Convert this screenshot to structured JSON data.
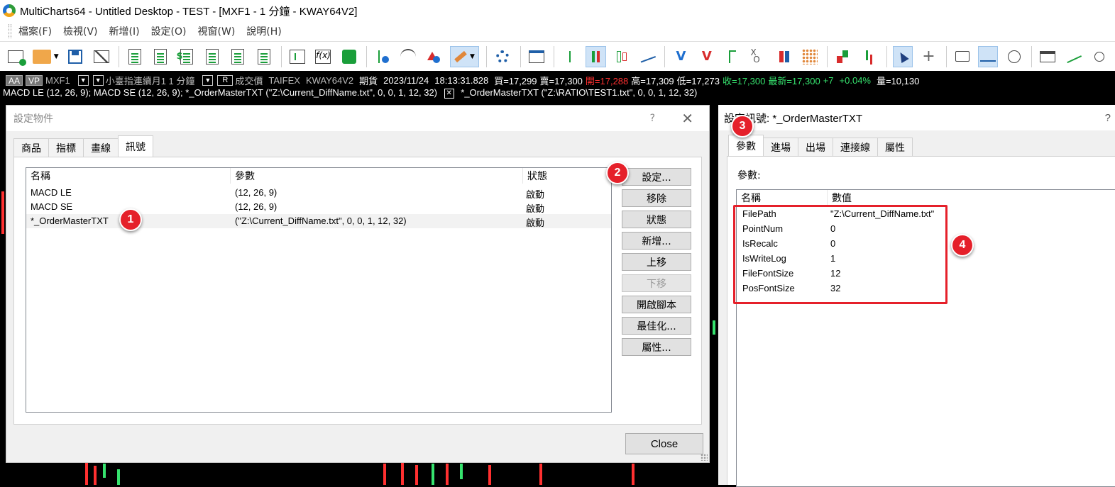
{
  "window": {
    "title": "MultiCharts64 - Untitled Desktop - TEST - [MXF1 - 1 分鐘 - KWAY64V2]"
  },
  "menu": [
    "檔案(F)",
    "檢視(V)",
    "新增(I)",
    "設定(O)",
    "視窗(W)",
    "說明(H)"
  ],
  "infobar": {
    "aa": "AA",
    "vp": "VP",
    "symbol": "MXF1",
    "desc": "小臺指連續月1 1 分鐘",
    "r": "R",
    "price_type": "成交價",
    "exchange": "TAIFEX",
    "strategy": "KWAY64V2",
    "kind": "期貨",
    "date": "2023/11/24",
    "time": "18:13:31.828",
    "bid": "買=17,299",
    "ask": "賣=17,300",
    "open": "開=17,288",
    "high": "高=17,309",
    "low": "低=17,273",
    "close": "收=17,300",
    "last": "最新=17,300",
    "chg": "+7",
    "pct": "+0.04%",
    "vol": "量=10,130",
    "signals_line_a": "MACD LE (12,  26,  9); MACD SE (12,  26,  9); *_OrderMasterTXT (\"Z:\\Current_DiffName.txt\",  0,  0,  1,  12,  32)",
    "signals_line_b": "*_OrderMasterTXT    (\"Z:\\RATIO\\TEST1.txt\",  0,  0,  1,  12,  32)"
  },
  "dialog_format": {
    "title": "設定物件",
    "help": "?",
    "close_x": "✕",
    "tabs": [
      "商品",
      "指標",
      "畫線",
      "訊號"
    ],
    "active_tab": 3,
    "columns": [
      "名稱",
      "參數",
      "狀態"
    ],
    "rows": [
      {
        "name": "MACD LE",
        "params": "(12, 26, 9)",
        "status": "啟動"
      },
      {
        "name": "MACD SE",
        "params": "(12, 26, 9)",
        "status": "啟動"
      },
      {
        "name": "*_OrderMasterTXT",
        "params": "(\"Z:\\Current_DiffName.txt\", 0, 0, 1, 12, 32)",
        "status": "啟動"
      }
    ],
    "buttons": [
      {
        "label": "設定...",
        "enabled": true
      },
      {
        "label": "移除",
        "enabled": true
      },
      {
        "label": "狀態",
        "enabled": true
      },
      {
        "label": "新增...",
        "enabled": true
      },
      {
        "label": "上移",
        "enabled": true
      },
      {
        "label": "下移",
        "enabled": false
      },
      {
        "label": "開啟腳本",
        "enabled": true
      },
      {
        "label": "最佳化...",
        "enabled": true
      },
      {
        "label": "屬性...",
        "enabled": true
      }
    ],
    "close_label": "Close"
  },
  "dialog_signal": {
    "title": "設定訊號: *_OrderMasterTXT",
    "help": "?",
    "tabs": [
      "參數",
      "進場",
      "出場",
      "連接線",
      "屬性"
    ],
    "active_tab": 0,
    "section_label": "參數:",
    "columns": [
      "名稱",
      "數值"
    ],
    "params": [
      {
        "name": "FilePath",
        "value": "\"Z:\\Current_DiffName.txt\""
      },
      {
        "name": "PointNum",
        "value": "0"
      },
      {
        "name": "IsRecalc",
        "value": "0"
      },
      {
        "name": "IsWriteLog",
        "value": "1"
      },
      {
        "name": "FileFontSize",
        "value": "12"
      },
      {
        "name": "PosFontSize",
        "value": "32"
      }
    ]
  },
  "markers": [
    "1",
    "2",
    "3",
    "4"
  ],
  "colors": {
    "marker": "#e5202a",
    "up": "#36e36e",
    "down": "#ff3030",
    "selection": "#cfe3f7"
  }
}
